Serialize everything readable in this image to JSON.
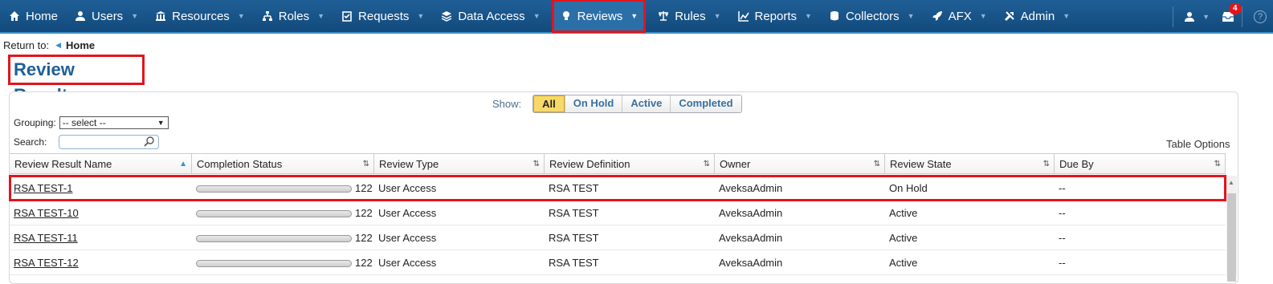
{
  "nav": {
    "items": [
      {
        "label": "Home",
        "icon": "home-icon"
      },
      {
        "label": "Users",
        "icon": "user-icon"
      },
      {
        "label": "Resources",
        "icon": "bank-icon"
      },
      {
        "label": "Roles",
        "icon": "sitemap-icon"
      },
      {
        "label": "Requests",
        "icon": "checklist-icon"
      },
      {
        "label": "Data Access",
        "icon": "layers-icon"
      },
      {
        "label": "Reviews",
        "icon": "lightbulb-icon"
      },
      {
        "label": "Rules",
        "icon": "scale-icon"
      },
      {
        "label": "Reports",
        "icon": "bar-chart-icon"
      },
      {
        "label": "Collectors",
        "icon": "database-icon"
      },
      {
        "label": "AFX",
        "icon": "rocket-icon"
      },
      {
        "label": "Admin",
        "icon": "tools-icon"
      }
    ],
    "active": "Reviews",
    "notification_count": "4",
    "help_symbol": "?"
  },
  "breadcrumb": {
    "prefix": "Return to:",
    "link": "Home"
  },
  "page_title": "Review Results",
  "filters": {
    "show_label": "Show:",
    "options": [
      "All",
      "On Hold",
      "Active",
      "Completed"
    ],
    "selected": "All"
  },
  "grouping": {
    "label": "Grouping:",
    "value": "-- select --"
  },
  "search": {
    "label": "Search:",
    "value": ""
  },
  "table_options_label": "Table Options",
  "table": {
    "columns": [
      "Review Result Name",
      "Completion Status",
      "Review Type",
      "Review Definition",
      "Owner",
      "Review State",
      "Due By"
    ],
    "rows": [
      {
        "name": "RSA TEST-1",
        "completion": 0,
        "count": "122",
        "type": "User Access",
        "definition": "RSA TEST",
        "owner": "AveksaAdmin",
        "state": "On Hold",
        "due": "--"
      },
      {
        "name": "RSA TEST-10",
        "completion": 0,
        "count": "122",
        "type": "User Access",
        "definition": "RSA TEST",
        "owner": "AveksaAdmin",
        "state": "Active",
        "due": "--"
      },
      {
        "name": "RSA TEST-11",
        "completion": 0,
        "count": "122",
        "type": "User Access",
        "definition": "RSA TEST",
        "owner": "AveksaAdmin",
        "state": "Active",
        "due": "--"
      },
      {
        "name": "RSA TEST-12",
        "completion": 0,
        "count": "122",
        "type": "User Access",
        "definition": "RSA TEST",
        "owner": "AveksaAdmin",
        "state": "Active",
        "due": "--"
      }
    ]
  }
}
